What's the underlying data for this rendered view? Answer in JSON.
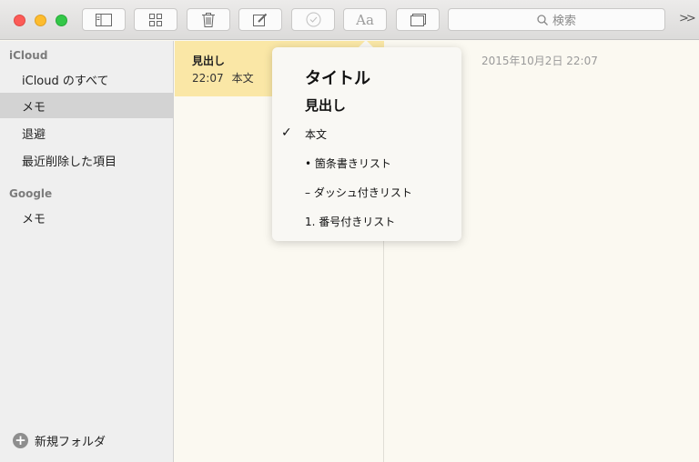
{
  "toolbar": {
    "buttons": [
      {
        "name": "sidebar-toggle",
        "icon": "sidebar-icon"
      },
      {
        "name": "attachments-browser",
        "icon": "grid-icon"
      },
      {
        "name": "delete",
        "icon": "trash-icon"
      },
      {
        "name": "new-note",
        "icon": "compose-icon"
      },
      {
        "name": "checklist",
        "icon": "checkmark-circle-icon"
      },
      {
        "name": "format",
        "icon": "text-style-icon",
        "label": "Aa"
      },
      {
        "name": "attachment",
        "icon": "window-icon"
      }
    ],
    "search_placeholder": "検索",
    "more_label": ">>"
  },
  "sidebar": {
    "sections": [
      {
        "label": "iCloud",
        "items": [
          {
            "label": "iCloud のすべて"
          },
          {
            "label": "メモ",
            "selected": true
          },
          {
            "label": "退避"
          },
          {
            "label": "最近削除した項目"
          }
        ]
      },
      {
        "label": "Google",
        "items": [
          {
            "label": "メモ"
          }
        ]
      }
    ],
    "new_folder_label": "新規フォルダ"
  },
  "note_list": {
    "notes": [
      {
        "title": "見出し",
        "time": "22:07",
        "preview": "本文"
      }
    ]
  },
  "editor": {
    "date": "2015年10月2日 22:07"
  },
  "format_popover": {
    "items": [
      {
        "label": "タイトル",
        "checked": false
      },
      {
        "label": "見出し",
        "checked": false
      },
      {
        "label": "本文",
        "checked": true,
        "check_glyph": "✓"
      },
      {
        "label": "• 箇条書きリスト",
        "checked": false
      },
      {
        "label": "– ダッシュ付きリスト",
        "checked": false
      },
      {
        "label": "1. 番号付きリスト",
        "checked": false
      }
    ]
  },
  "colors": {
    "selected_note": "#fae7a6",
    "sidebar_bg": "#efefef",
    "paper_bg": "#fbf9f1"
  }
}
